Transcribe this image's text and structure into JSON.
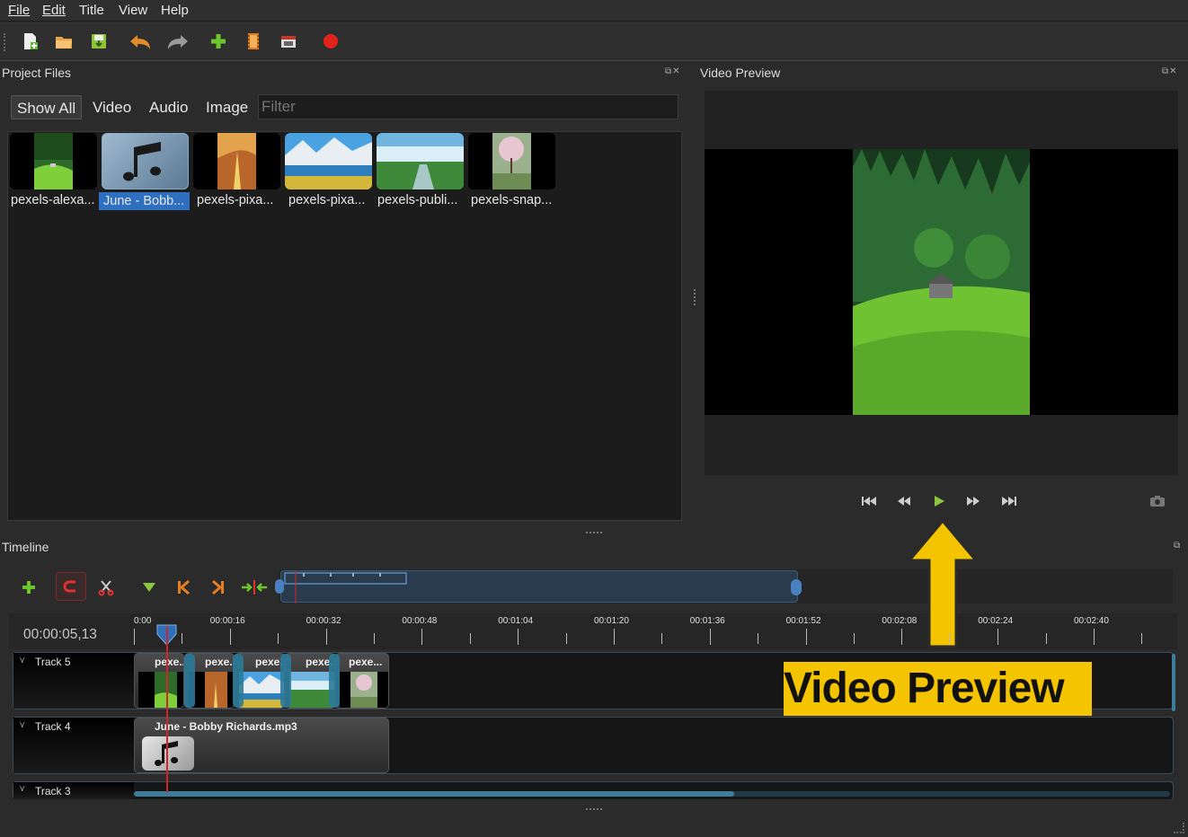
{
  "menu": {
    "file": "File",
    "edit": "Edit",
    "title": "Title",
    "view": "View",
    "help": "Help"
  },
  "project_files": {
    "title": "Project Files",
    "filters": {
      "show_all": "Show All",
      "video": "Video",
      "audio": "Audio",
      "image": "Image"
    },
    "filter_placeholder": "Filter",
    "items": [
      {
        "label": "pexels-alexa..."
      },
      {
        "label": "June - Bobb..."
      },
      {
        "label": "pexels-pixa..."
      },
      {
        "label": "pexels-pixa..."
      },
      {
        "label": "pexels-publi..."
      },
      {
        "label": "pexels-snap..."
      }
    ]
  },
  "video_preview": {
    "title": "Video Preview"
  },
  "timeline": {
    "title": "Timeline",
    "current_time": "00:00:05,13",
    "ruler_labels": [
      "0:00",
      "00:00:16",
      "00:00:32",
      "00:00:48",
      "00:01:04",
      "00:01:20",
      "00:01:36",
      "00:01:52",
      "00:02:08",
      "00:02:24",
      "00:02:40",
      "00"
    ],
    "tracks": [
      {
        "name": "Track 5",
        "clips": [
          "pexe...",
          "pexe...",
          "pexe...",
          "pexe...",
          "pexe..."
        ]
      },
      {
        "name": "Track 4",
        "clips": [
          "June - Bobby Richards.mp3"
        ]
      },
      {
        "name": "Track 3",
        "clips": []
      }
    ]
  },
  "annotation": {
    "text": "Video Preview",
    "color": "#f5c400",
    "arrow_color": "#f5c400"
  }
}
